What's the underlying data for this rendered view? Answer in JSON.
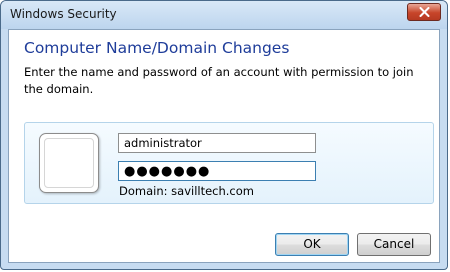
{
  "window": {
    "title": "Windows Security"
  },
  "dialog": {
    "heading": "Computer Name/Domain Changes",
    "message": "Enter the name and password of an account with permission to join the domain."
  },
  "credentials": {
    "username_value": "administrator",
    "password_value": "●●●●●●●",
    "domain_text": "Domain: savilltech.com"
  },
  "buttons": {
    "ok_label": "OK",
    "cancel_label": "Cancel"
  },
  "colors": {
    "heading": "#1f3d9a",
    "frame": "#c7dcf1",
    "close_button": "#c7452a",
    "focus_border": "#3c7fb1"
  },
  "icons": {
    "close": "close-icon",
    "user_tile": "user-avatar-tile"
  }
}
